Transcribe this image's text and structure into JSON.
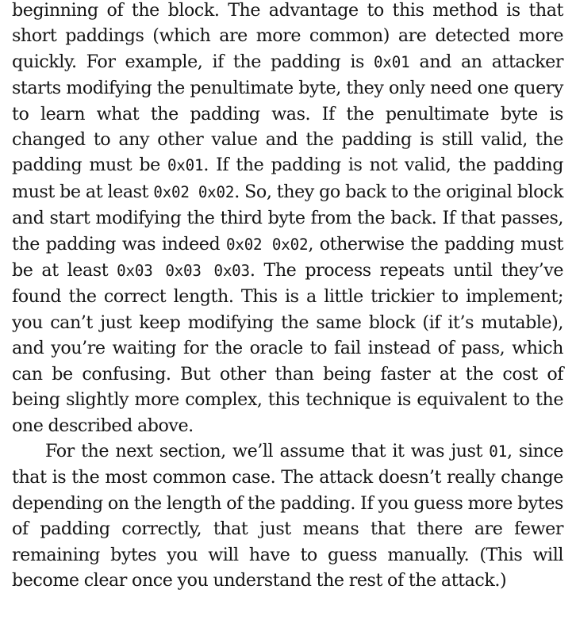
{
  "paragraph_1": {
    "seg_01": "beginning of the block. The advantage to this method is that short paddings (which are more common) are detected more quickly. For example, if the padding is ",
    "code_01": "0x01",
    "seg_02": " and an at­tacker starts modifying the penultimate byte, they only need one query to learn what the padding was. If the penultimate byte is changed to any other value and the padding is still valid, the padding must be ",
    "code_02": "0x01",
    "seg_03": ". If the padding is not valid, the padding must be at least ",
    "code_03": "0x02 0x02",
    "seg_04": ". So, they go back to the original block and start modifying the third byte from the back. If that passes, the padding was indeed ",
    "code_04": "0x02 0x02",
    "seg_05": ", otherwise the padding must be at least ",
    "code_05": "0x03 0x03 0x03",
    "seg_06": ". The process repeats until they’ve found the correct length. This is a little trickier to implement; you can’t just keep mod­ifying the same block (if it’s mutable), and you’re waiting for the oracle to fail instead of pass, which can be confusing. But other than being faster at the cost of being slightly more complex, this technique is equivalent to the one described above."
  },
  "paragraph_2": {
    "seg_01": "For the next section, we’ll assume that it was just ",
    "code_01": "01",
    "seg_02": ", since that is the most common case. The attack doesn’t re­ally change depending on the length of the padding. If you guess more bytes of padding correctly, that just means that there are fewer remaining bytes you will have to guess man­ually. (This will become clear once you understand the rest of the attack.)"
  }
}
